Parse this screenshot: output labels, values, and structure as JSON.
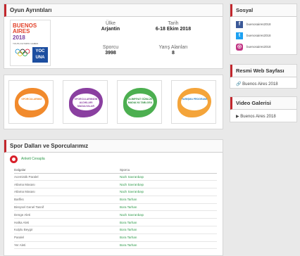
{
  "details": {
    "title": "Oyun Ayrıntıları",
    "logo_line1": "BUENOS",
    "logo_line2": "AIRES",
    "logo_line3": "2018",
    "logo_small": "YOUTH OLYMPIC GAMES",
    "yoc": "YOC\nUNA",
    "country_label": "Ülke",
    "country_value": "Arjantin",
    "date_label": "Tarih",
    "date_value": "6-18 Ekim 2018",
    "athlete_label": "Sporcu",
    "athlete_value": "3998",
    "venue_label": "Yarış Alanları",
    "venue_value": "8"
  },
  "tiles": [
    {
      "label": "SPORCULARIMIZ",
      "color": "#f18a2c"
    },
    {
      "label": "SPORCULARIMIZIN ALDIKLARI MADALYALAR",
      "color": "#8a3fa0"
    },
    {
      "label": "OLİMPİYAT GÜNLÜK MADALYA TABLOSU",
      "color": "#4caf50"
    },
    {
      "label": "YARIŞMA PROGRAMI",
      "color": "#f4a43a"
    }
  ],
  "sports": {
    "title": "Spor Dalları ve Sporcularımız",
    "country_link": "Anketi Cevapla",
    "header_sport": "Dalgalar",
    "header_athlete": "Sporcu",
    "rows": [
      {
        "sport": "Acemistik Paralel",
        "athlete": "Nazlı Savranbaşı"
      },
      {
        "sport": "Atlama Masası",
        "athlete": "Nazlı Savranbaşı"
      },
      {
        "sport": "Atlama Masası",
        "athlete": "Nazlı Savranbaşı"
      },
      {
        "sport": "Barfiks",
        "athlete": "Bora Tarhan"
      },
      {
        "sport": "Bireysel Genel Tasnif",
        "athlete": "Bora Tarhan"
      },
      {
        "sport": "Denge Aleti",
        "athlete": "Nazlı Savranbaşı"
      },
      {
        "sport": "Halka Aleti",
        "athlete": "Bora Tarhan"
      },
      {
        "sport": "Kulplu Beygir",
        "athlete": "Bora Tarhan"
      },
      {
        "sport": "Paralel",
        "athlete": "Bora Tarhan"
      },
      {
        "sport": "Yer Aleti",
        "athlete": "Bora Tarhan"
      }
    ]
  },
  "sosyal": {
    "title": "Sosyal",
    "facebook": "buenosaires2018",
    "twitter": "buenosaires2018",
    "instagram": "buenosaires2018"
  },
  "resmi": {
    "title": "Resmi Web Sayfası",
    "link": "Buenos Aires 2018"
  },
  "video": {
    "title": "Video Galerisi",
    "link": "Buenos Aires 2018"
  }
}
